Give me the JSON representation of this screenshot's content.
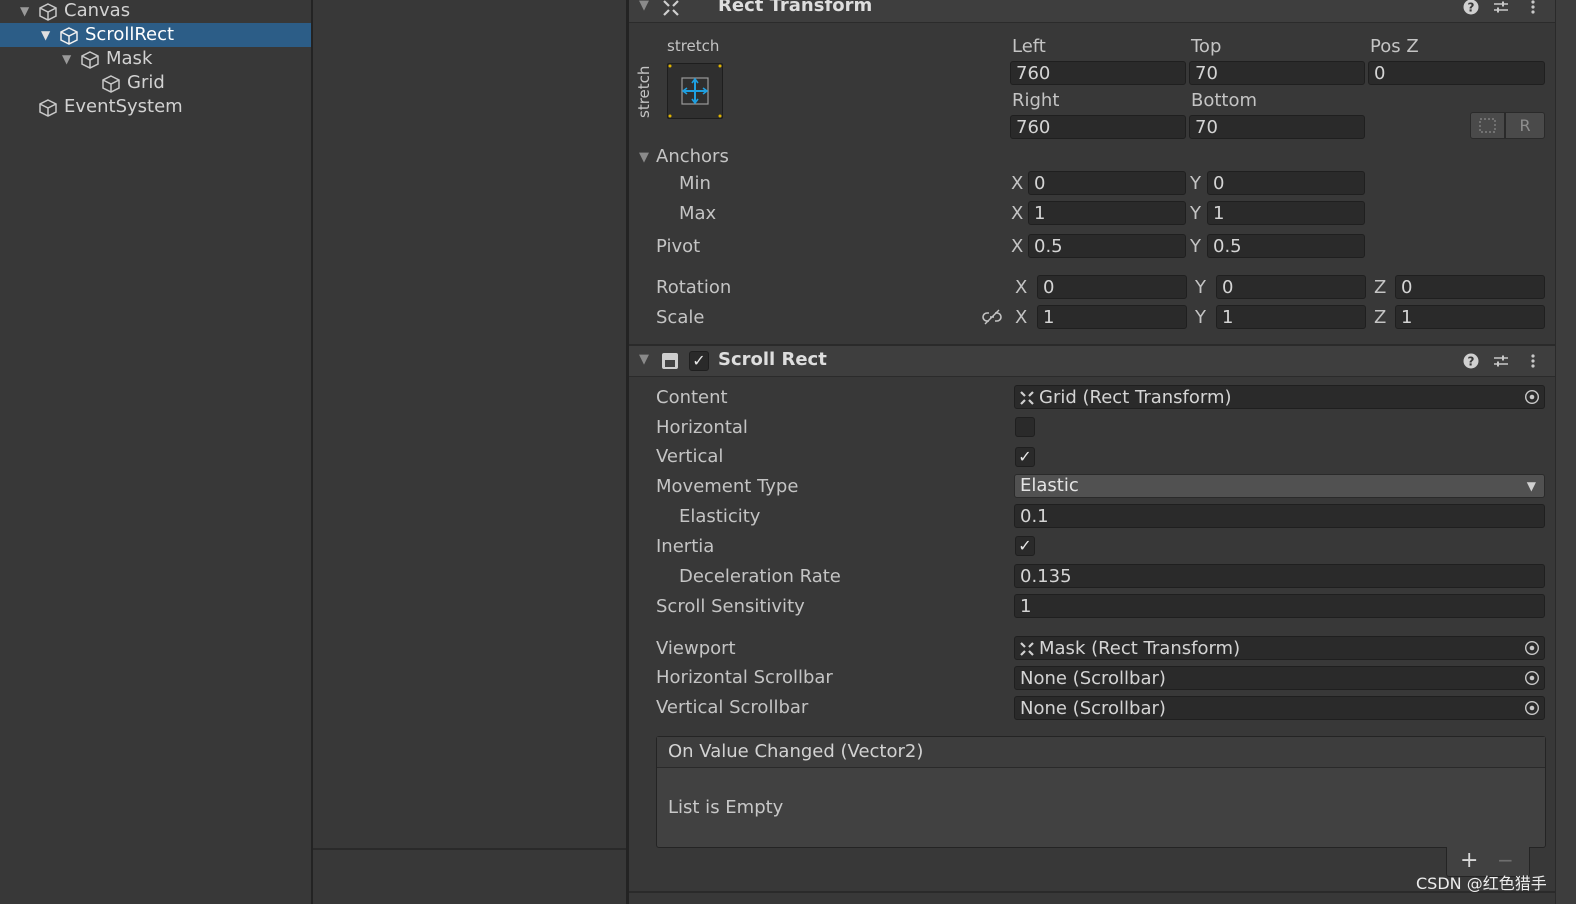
{
  "hierarchy": {
    "items": [
      {
        "label": "Canvas"
      },
      {
        "label": "ScrollRect"
      },
      {
        "label": "Mask"
      },
      {
        "label": "Grid"
      },
      {
        "label": "EventSystem"
      }
    ]
  },
  "rect_transform": {
    "title": "Rect Transform",
    "anchor_preset_top": "stretch",
    "anchor_preset_side": "stretch",
    "col1_label": "Left",
    "col2_label": "Top",
    "col3_label": "Pos Z",
    "left": "760",
    "top": "70",
    "pos_z": "0",
    "row2_col1_label": "Right",
    "row2_col2_label": "Bottom",
    "right": "760",
    "bottom": "70",
    "raw_button": "R",
    "anchors_label": "Anchors",
    "min_label": "Min",
    "min_x": "0",
    "min_y": "0",
    "max_label": "Max",
    "max_x": "1",
    "max_y": "1",
    "pivot_label": "Pivot",
    "pivot_x": "0.5",
    "pivot_y": "0.5",
    "rotation_label": "Rotation",
    "rot_x": "0",
    "rot_y": "0",
    "rot_z": "0",
    "scale_label": "Scale",
    "scale_x": "1",
    "scale_y": "1",
    "scale_z": "1",
    "axis_x": "X",
    "axis_y": "Y",
    "axis_z": "Z"
  },
  "scroll_rect": {
    "title": "Scroll Rect",
    "enabled": true,
    "content_label": "Content",
    "content_value": "Grid (Rect Transform)",
    "horizontal_label": "Horizontal",
    "horizontal": false,
    "vertical_label": "Vertical",
    "vertical": true,
    "movement_type_label": "Movement Type",
    "movement_type": "Elastic",
    "elasticity_label": "Elasticity",
    "elasticity": "0.1",
    "inertia_label": "Inertia",
    "inertia": true,
    "deceleration_label": "Deceleration Rate",
    "deceleration": "0.135",
    "sensitivity_label": "Scroll Sensitivity",
    "sensitivity": "1",
    "viewport_label": "Viewport",
    "viewport_value": "Mask (Rect Transform)",
    "hscroll_label": "Horizontal Scrollbar",
    "hscroll_value": "None (Scrollbar)",
    "vscroll_label": "Vertical Scrollbar",
    "vscroll_value": "None (Scrollbar)",
    "event_title": "On Value Changed (Vector2)",
    "event_empty": "List is Empty",
    "add_glyph": "+",
    "remove_glyph": "−"
  },
  "watermark": "CSDN @红色猎手",
  "colors": {
    "selection": "#2c5d87",
    "accent_blue": "#1e9fe0",
    "anchor_dot": "#e0b400"
  }
}
